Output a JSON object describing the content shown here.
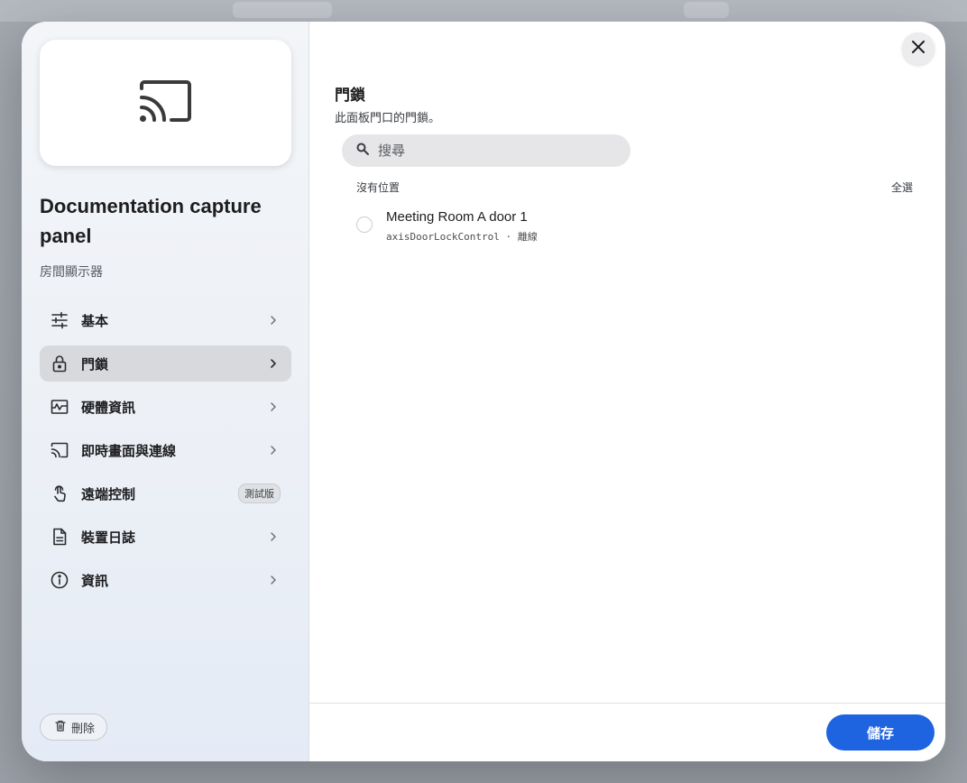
{
  "device": {
    "title": "Documentation capture panel",
    "type": "房間顯示器",
    "preview_icon": "cast-icon"
  },
  "sidebar": {
    "items": [
      {
        "label": "基本",
        "icon": "sliders-icon"
      },
      {
        "label": "門鎖",
        "icon": "lock-icon"
      },
      {
        "label": "硬體資訊",
        "icon": "monitor-activity-icon"
      },
      {
        "label": "即時畫面與連線",
        "icon": "cast-icon"
      },
      {
        "label": "遠端控制",
        "icon": "touch-icon",
        "badge": "測試版"
      },
      {
        "label": "裝置日誌",
        "icon": "document-icon"
      },
      {
        "label": "資訊",
        "icon": "info-icon"
      }
    ],
    "active_index": 1,
    "delete_label": "刪除"
  },
  "main": {
    "section_title": "門鎖",
    "section_description": "此面板門口的門鎖。",
    "search": {
      "placeholder": "搜尋",
      "value": ""
    },
    "group_label": "沒有位置",
    "select_all_label": "全選",
    "locks": [
      {
        "name": "Meeting Room A door 1",
        "type": "axisDoorLockControl",
        "status": "離線",
        "selected": false
      }
    ],
    "save_label": "儲存"
  },
  "colors": {
    "accent": "#1e63e0",
    "active_nav": "#d7d9dd"
  }
}
